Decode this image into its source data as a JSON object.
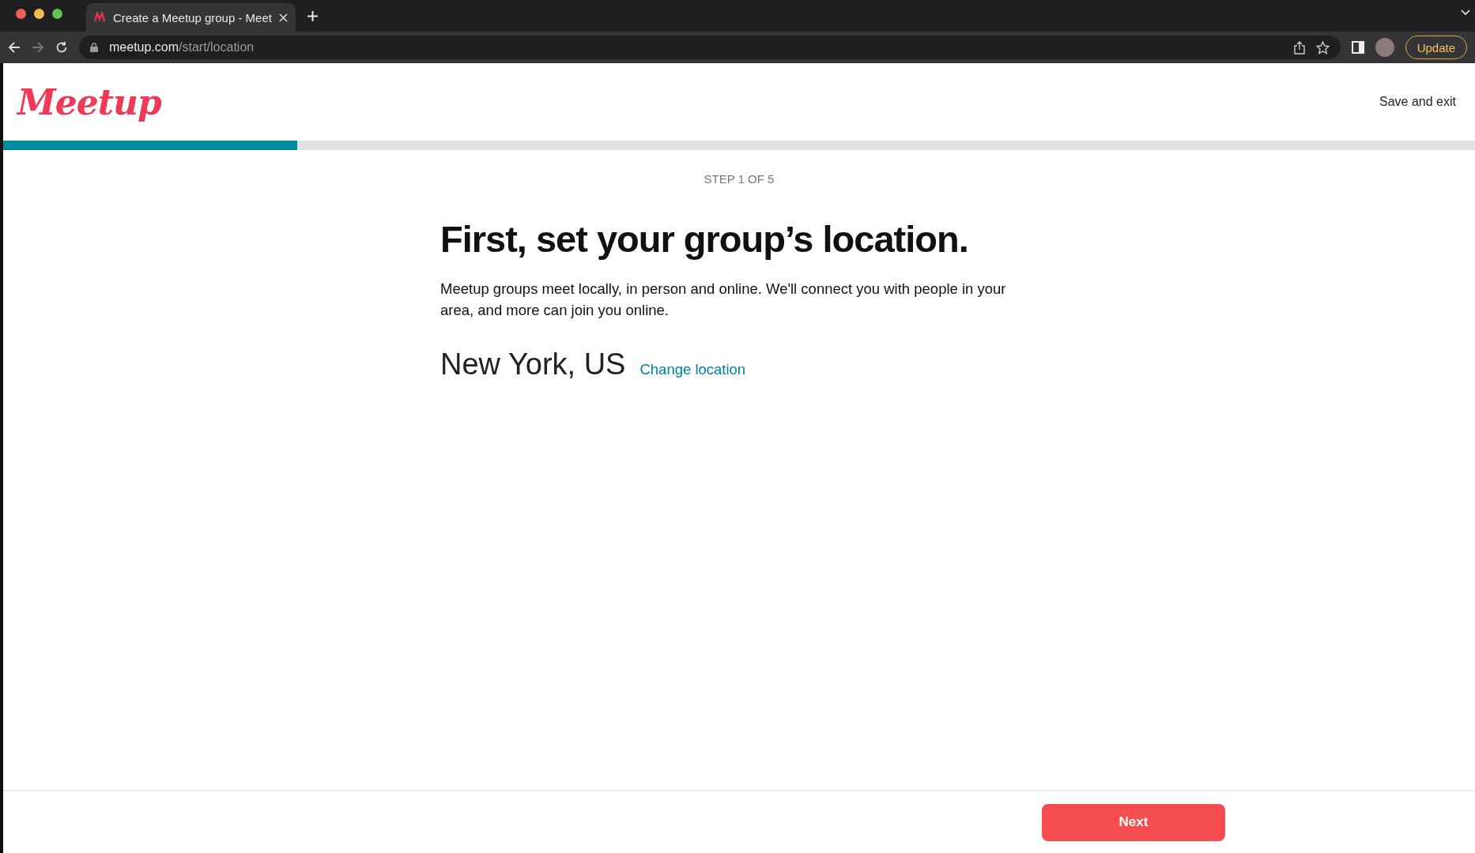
{
  "browser": {
    "tab": {
      "title": "Create a Meetup group - Meet",
      "selected": true
    },
    "url_host": "meetup.com",
    "url_path": "/start/location",
    "update_button": "Update"
  },
  "header": {
    "logo": "Meetup",
    "save_exit": "Save and exit"
  },
  "progress": {
    "level": 0.2
  },
  "step": "STEP 1 OF 5",
  "title": "First, set your group’s location.",
  "description": "Meetup groups meet locally, in person and online. We'll connect you with people in your area, and more can join you online.",
  "location": "New York, US",
  "change_location": "Change location",
  "next_button": "Next"
}
